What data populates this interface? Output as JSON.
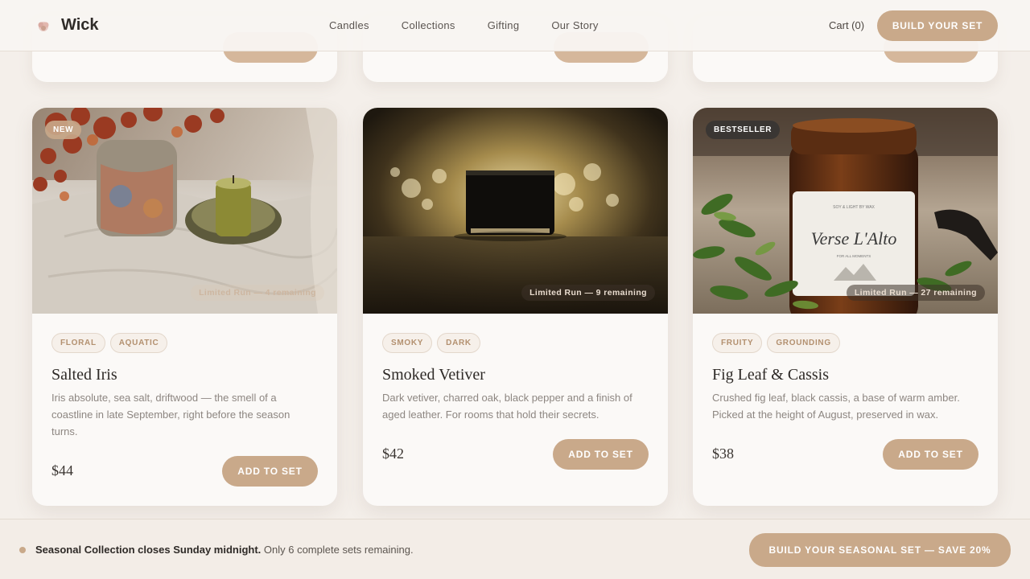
{
  "header": {
    "brand": "Wick",
    "nav": [
      "Candles",
      "Collections",
      "Gifting",
      "Our Story"
    ],
    "cart": "Cart (0)",
    "cta": "BUILD YOUR SET"
  },
  "products": [
    {
      "badge": "NEW",
      "limited": "Limited Run — 4 remaining",
      "tags": [
        "FLORAL",
        "AQUATIC"
      ],
      "name": "Salted Iris",
      "description": "Iris absolute, sea salt, driftwood — the smell of a coastline in late September, right before the season turns.",
      "price": "$44",
      "button": "ADD TO SET"
    },
    {
      "badge": "",
      "limited": "Limited Run — 9 remaining",
      "tags": [
        "SMOKY",
        "DARK"
      ],
      "name": "Smoked Vetiver",
      "description": "Dark vetiver, charred oak, black pepper and a finish of aged leather. For rooms that hold their secrets.",
      "price": "$42",
      "button": "ADD TO SET"
    },
    {
      "badge": "BESTSELLER",
      "limited": "Limited Run — 27 remaining",
      "tags": [
        "FRUITY",
        "GROUNDING"
      ],
      "name": "Fig Leaf & Cassis",
      "description": "Crushed fig leaf, black cassis, a base of warm amber. Picked at the height of August, preserved in wax.",
      "price": "$38",
      "button": "ADD TO SET"
    }
  ],
  "jar_label": {
    "line1": "SOY & LIGHT BY WAX",
    "script": "Verse L'Alto",
    "line2": "FOR ALL MOMENTS"
  },
  "bottom_bar": {
    "bold": "Seasonal Collection closes Sunday midnight.",
    "rest": " Only 6 complete sets remaining.",
    "cta": "BUILD YOUR SEASONAL SET — SAVE 20%"
  },
  "colors": {
    "accent": "#c9a98a",
    "background": "#f4efea",
    "card": "#fbf9f7"
  }
}
